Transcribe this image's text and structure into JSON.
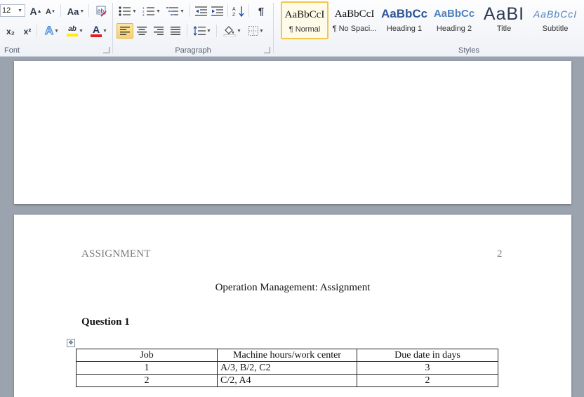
{
  "font_group": {
    "label": "Font",
    "font_size": "12",
    "grow_label": "A",
    "shrink_label": "A",
    "change_case_label": "Aa",
    "subscript_label": "x₂",
    "superscript_label": "x²",
    "text_effects_label": "A",
    "highlight_label": "ab",
    "font_color_label": "A",
    "font_color": "#e02020",
    "highlight_color": "#ffee00"
  },
  "paragraph_group": {
    "label": "Paragraph",
    "show_marks_label": "¶"
  },
  "styles_group": {
    "label": "Styles",
    "items": [
      {
        "sample": "AaBbCcI",
        "name": "¶ Normal"
      },
      {
        "sample": "AaBbCcI",
        "name": "¶ No Spaci..."
      },
      {
        "sample": "AaBbCc",
        "name": "Heading 1"
      },
      {
        "sample": "AaBbCc",
        "name": "Heading 2"
      },
      {
        "sample": "AaBI",
        "name": "Title"
      },
      {
        "sample": "AaBbCcI",
        "name": "Subtitle"
      }
    ]
  },
  "document": {
    "header_left": "ASSIGNMENT",
    "page_number": "2",
    "title": "Operation Management: Assignment",
    "question_heading": "Question 1",
    "table": {
      "headers": [
        "Job",
        "Machine hours/work center",
        "Due date in days"
      ],
      "rows": [
        [
          "1",
          "A/3, B/2, C2",
          "3"
        ],
        [
          "2",
          "C/2, A4",
          "2"
        ]
      ]
    }
  }
}
